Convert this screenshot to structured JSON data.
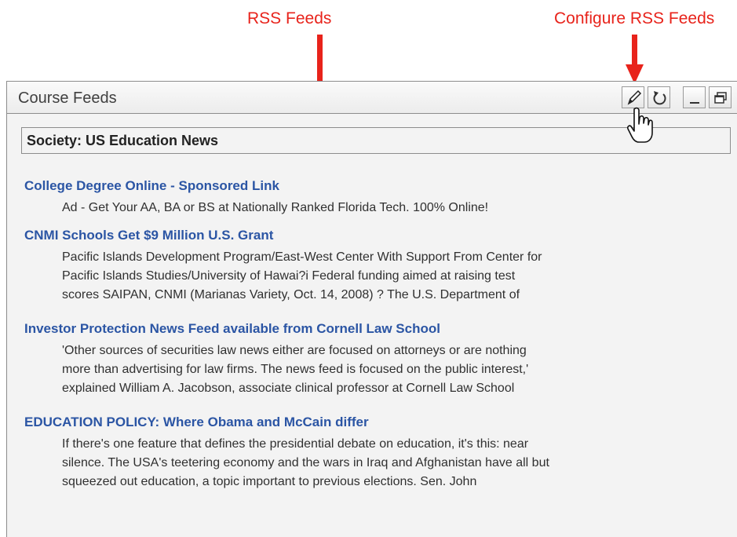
{
  "annotations": {
    "rss_feeds": "RSS Feeds",
    "configure": "Configure RSS Feeds",
    "color": "#e8231b"
  },
  "panel": {
    "title": "Course Feeds",
    "buttons": [
      {
        "name": "edit",
        "icon": "pencil-icon"
      },
      {
        "name": "refresh",
        "icon": "refresh-icon"
      },
      {
        "name": "minimize",
        "icon": "minimize-icon"
      },
      {
        "name": "restore",
        "icon": "restore-icon"
      }
    ]
  },
  "feed": {
    "title": "Society: US Education News",
    "items": [
      {
        "title": "College Degree Online - Sponsored Link",
        "desc": [
          "Ad - Get Your AA, BA or BS at Nationally Ranked Florida Tech. 100% Online!"
        ]
      },
      {
        "title": "CNMI Schools Get $9 Million U.S. Grant",
        "desc": [
          "Pacific Islands Development Program/East-West Center With Support From Center for",
          "Pacific Islands Studies/University of Hawai?i Federal funding aimed at raising test",
          "scores SAIPAN, CNMI (Marianas Variety, Oct. 14, 2008) ? The U.S. Department of"
        ]
      },
      {
        "title": "Investor Protection News Feed available from Cornell Law School",
        "desc": [
          "'Other sources of securities law news either are focused on attorneys or are nothing",
          "more than advertising for law firms. The news feed is focused on the public interest,'",
          "explained William A. Jacobson, associate clinical professor at Cornell Law School"
        ]
      },
      {
        "title": "EDUCATION POLICY: Where Obama and McCain differ",
        "desc": [
          "If there's one feature that defines the presidential debate on education, it's this: near",
          "silence. The USA's teetering economy and the wars in Iraq and Afghanistan have all but",
          "squeezed out education, a topic important to previous elections. Sen. John"
        ]
      }
    ]
  }
}
